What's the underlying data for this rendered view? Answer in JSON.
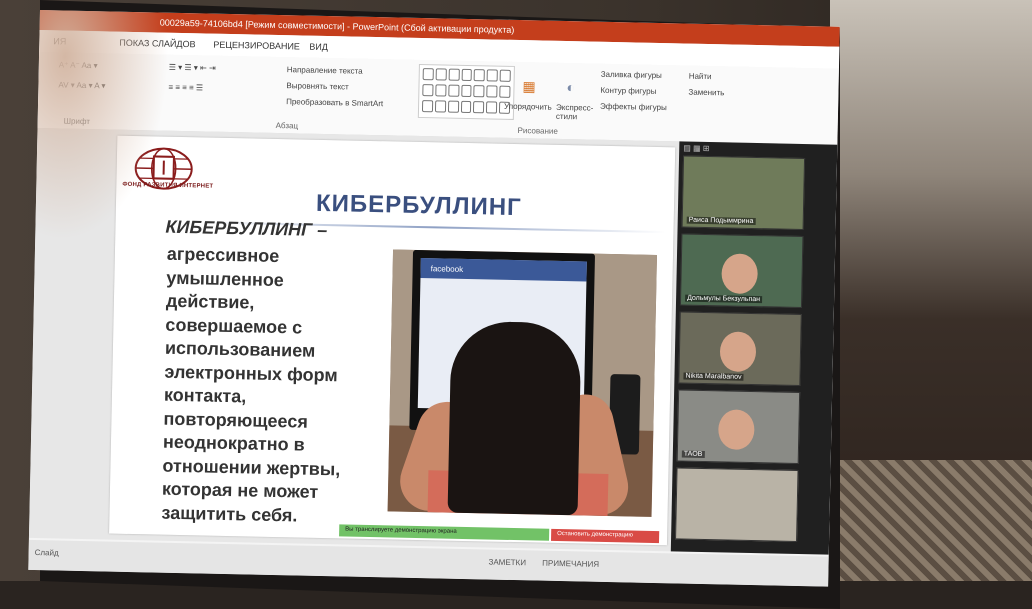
{
  "window": {
    "title": "00029a59-74106bd4 [Режим совместимости] - PowerPoint (Сбой активации продукта)"
  },
  "ribbon_tabs": [
    "ИЯ",
    "ПОКАЗ СЛАЙДОВ",
    "РЕЦЕНЗИРОВАНИЕ",
    "ВИД"
  ],
  "ribbon": {
    "font_group_label": "Шрифт",
    "paragraph_group_label": "Абзац",
    "drawing_group_label": "Рисование",
    "text_direction": "Направление текста",
    "align_text": "Выровнять текст",
    "convert_smartart": "Преобразовать в SmartArt",
    "arrange": "Упорядочить",
    "quick_styles": "Экспресс-стили",
    "shape_fill": "Заливка фигуры",
    "shape_outline": "Контур фигуры",
    "shape_effects": "Эффекты фигуры",
    "find": "Найти",
    "replace": "Заменить"
  },
  "slide": {
    "logo_text": "ФОНД РАЗВИТИЯ ИНТЕРНЕТ",
    "title": "КИБЕРБУЛЛИНГ",
    "term": "КИБЕРБУЛЛИНГ –",
    "definition_lines": [
      "агрессивное",
      "умышленное",
      "действие,",
      "совершаемое с",
      "использованием",
      "электронных форм",
      "контакта,",
      "повторяющееся",
      "неоднократно в",
      "отношении жертвы,",
      "которая не может",
      "защитить себя."
    ],
    "photo_screen_brand": "facebook"
  },
  "video_gallery": {
    "participants": [
      {
        "name": "Раиса Подыммрина"
      },
      {
        "name": "Дольмулы Бекзульпан"
      },
      {
        "name": "Nikita Maralbanov"
      },
      {
        "name": "TAOB"
      },
      {
        "name": ""
      }
    ]
  },
  "share_banner": {
    "status_text": "Вы транслируете демонстрацию экрана",
    "stop_label": "Остановить демонстрацию"
  },
  "statusbar": {
    "left": "Слайд",
    "notes": "ЗАМЕТКИ",
    "comments": "ПРИМЕЧАНИЯ"
  }
}
